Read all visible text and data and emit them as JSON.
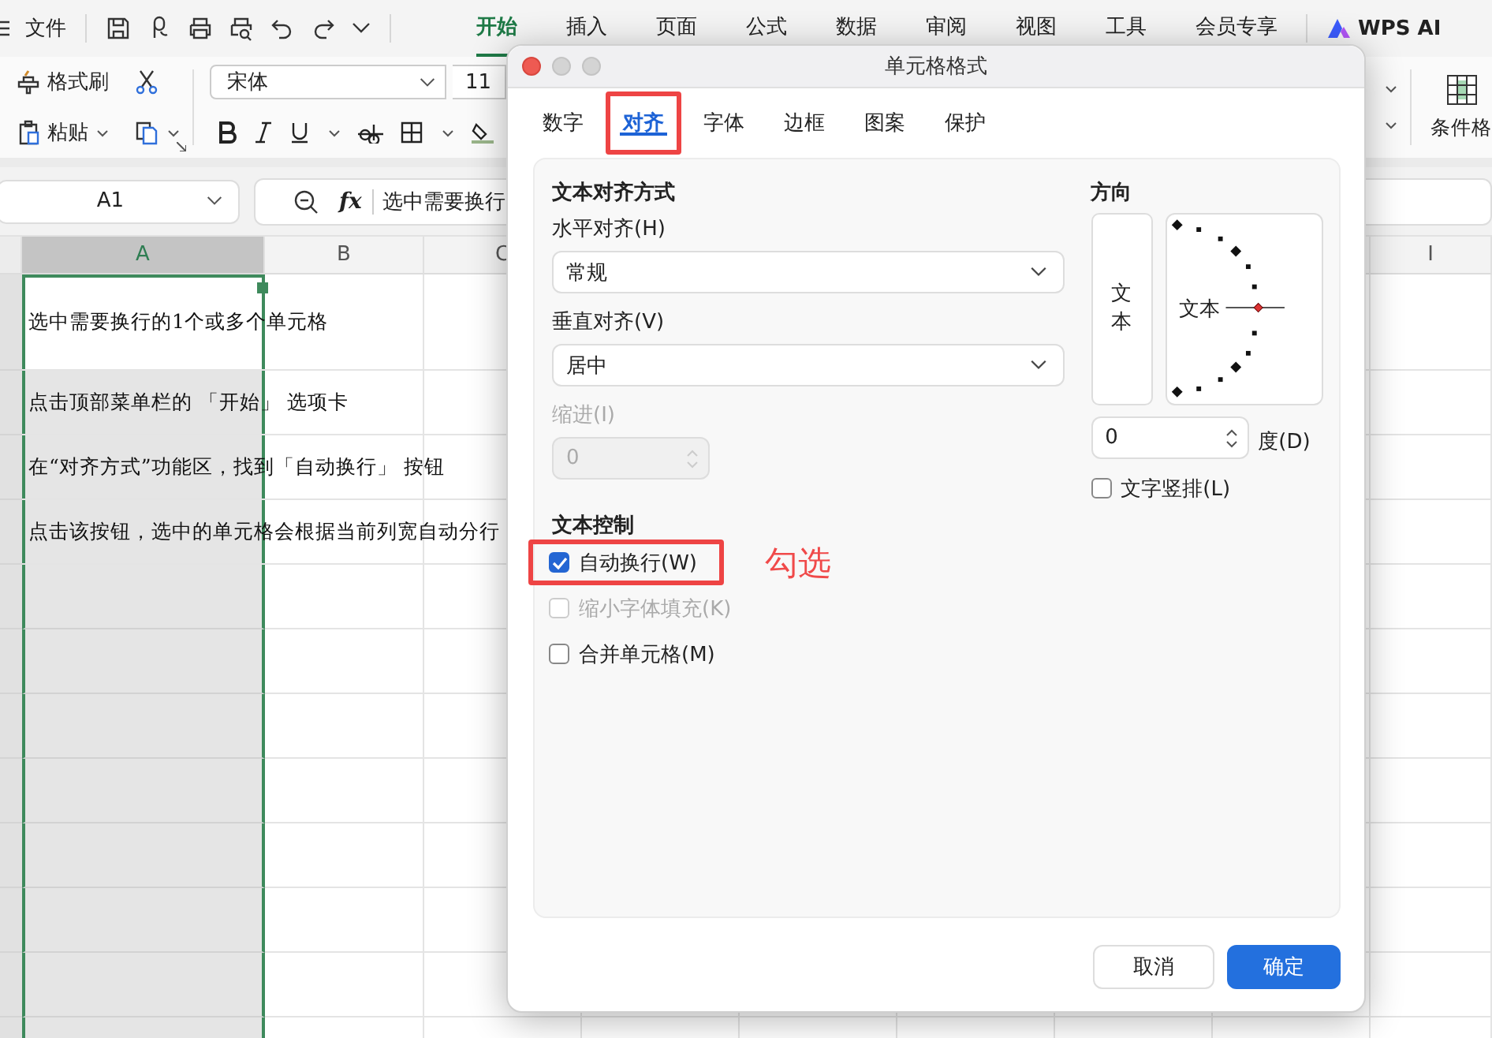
{
  "menu_bar": {
    "file_label": "文件",
    "tabs": [
      {
        "label": "开始",
        "selected": true
      },
      {
        "label": "插入",
        "selected": false
      },
      {
        "label": "页面",
        "selected": false
      },
      {
        "label": "公式",
        "selected": false
      },
      {
        "label": "数据",
        "selected": false
      },
      {
        "label": "审阅",
        "selected": false
      },
      {
        "label": "视图",
        "selected": false
      },
      {
        "label": "工具",
        "selected": false
      },
      {
        "label": "会员专享",
        "selected": false
      }
    ],
    "ai_label": "WPS AI"
  },
  "ribbon": {
    "format_painter": "格式刷",
    "paste": "粘贴",
    "font_name": "宋体",
    "font_size": "11",
    "conditional_format": "条件格"
  },
  "formula_bar": {
    "cell_ref": "A1",
    "function_label": "fx",
    "content": "选中需要换行"
  },
  "sheet": {
    "columns": [
      {
        "label": "A",
        "selected": true
      },
      {
        "label": "B",
        "selected": false
      },
      {
        "label": "C",
        "selected": false
      },
      {
        "label": "I",
        "selected": false
      }
    ],
    "rows": [
      {
        "text": "选中需要换行的1个或多个单元格"
      },
      {
        "text": "点击顶部菜单栏的 「开始」 选项卡"
      },
      {
        "text": "在“对齐方式”功能区，找到「自动换行」 按钮"
      },
      {
        "text": "点击该按钮，选中的单元格会根据当前列宽自动分行"
      }
    ]
  },
  "dialog": {
    "title": "单元格格式",
    "tabs": [
      {
        "label": "数字",
        "selected": false,
        "highlighted": false
      },
      {
        "label": "对齐",
        "selected": true,
        "highlighted": true
      },
      {
        "label": "字体",
        "selected": false,
        "highlighted": false
      },
      {
        "label": "边框",
        "selected": false,
        "highlighted": false
      },
      {
        "label": "图案",
        "selected": false,
        "highlighted": false
      },
      {
        "label": "保护",
        "selected": false,
        "highlighted": false
      }
    ],
    "alignment": {
      "heading": "文本对齐方式",
      "horizontal_label": "水平对齐(H)",
      "horizontal_value": "常规",
      "vertical_label": "垂直对齐(V)",
      "vertical_value": "居中",
      "indent_label": "缩进(I)",
      "indent_value": "0",
      "indent_disabled": true
    },
    "orientation": {
      "heading": "方向",
      "vertical_text": "文本",
      "dial_text": "文本",
      "degrees_value": "0",
      "degrees_label": "度(D)",
      "vertical_stack": {
        "label": "文字竖排(L)",
        "checked": false
      }
    },
    "text_control": {
      "heading": "文本控制",
      "options": [
        {
          "label": "自动换行(W)",
          "checked": true,
          "disabled": false,
          "highlighted": true
        },
        {
          "label": "缩小字体填充(K)",
          "checked": false,
          "disabled": true,
          "highlighted": false
        },
        {
          "label": "合并单元格(M)",
          "checked": false,
          "disabled": false,
          "highlighted": false
        }
      ]
    },
    "callout": "勾选",
    "buttons": [
      {
        "label": "取消",
        "kind": "secondary"
      },
      {
        "label": "确定",
        "kind": "primary"
      }
    ]
  }
}
